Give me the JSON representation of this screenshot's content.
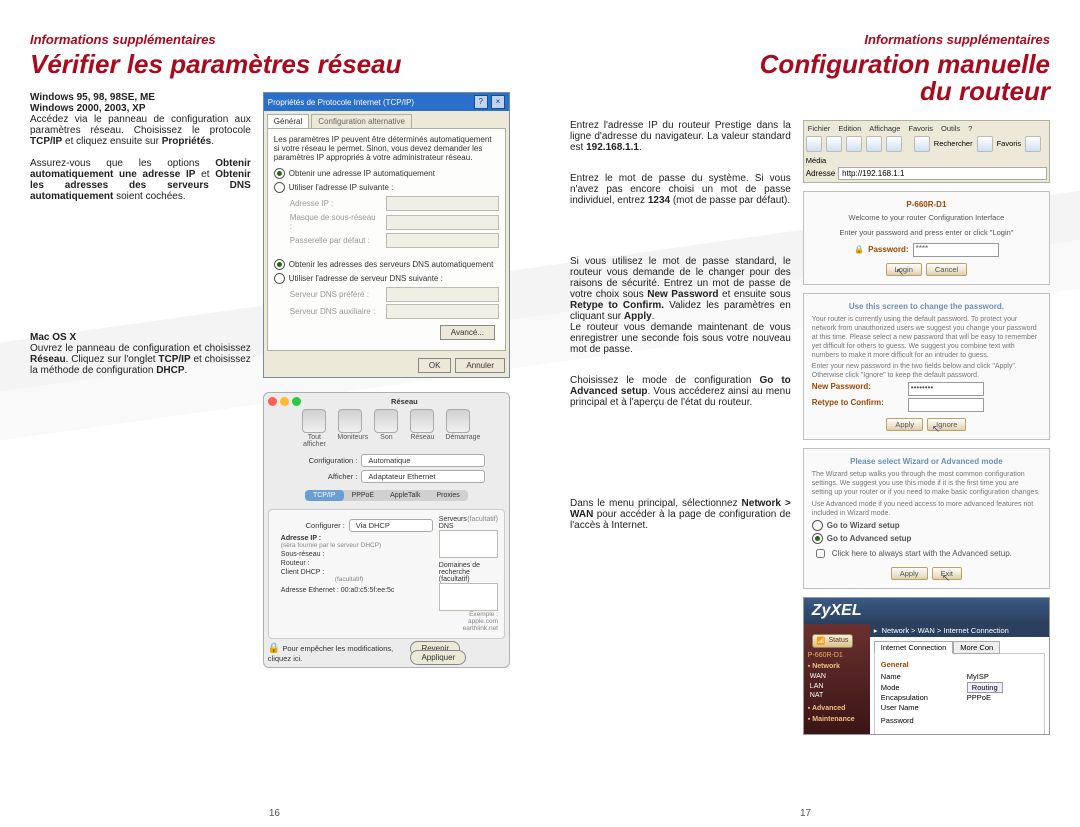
{
  "left": {
    "subheader": "Informations supplémentaires",
    "title": "Vérifier les paramètres réseau",
    "page_num": "16",
    "win_section": {
      "heading1": "Windows 95, 98, 98SE, ME",
      "heading2": "Windows 2000, 2003, XP",
      "p1a": "Accédez via le panneau de configuration aux paramètres réseau. Choisissez le protocole ",
      "p1b": "TCP/IP",
      "p1c": " et cliquez ensuite sur ",
      "p1d": "Propriétés",
      "p1e": ".",
      "p2a": "Assurez-vous que les options ",
      "p2b": "Obtenir automatiquement une adresse IP",
      "p2c": " et ",
      "p2d": "Obtenir les adresses des serveurs DNS automatiquement",
      "p2e": " soient cochées."
    },
    "mac_section": {
      "heading": "Mac OS X",
      "p1a": "Ouvrez le panneau de configuration et choisissez ",
      "p1b": "Réseau",
      "p1c": ". Cliquez sur l'onglet ",
      "p1d": "TCP/IP",
      "p1e": " et choisissez la méthode de configuration ",
      "p1f": "DHCP",
      "p1g": "."
    },
    "tcpip_dialog": {
      "title": "Propriétés de Protocole Internet (TCP/IP)",
      "tab1": "Général",
      "tab2": "Configuration alternative",
      "desc": "Les paramètres IP peuvent être déterminés automatiquement si votre réseau le permet. Sinon, vous devez demander les paramètres IP appropriés à votre administrateur réseau.",
      "r1": "Obtenir une adresse IP automatiquement",
      "r2": "Utiliser l'adresse IP suivante :",
      "f1": "Adresse IP :",
      "f2": "Masque de sous-réseau :",
      "f3": "Passerelle par défaut :",
      "r3": "Obtenir les adresses des serveurs DNS automatiquement",
      "r4": "Utiliser l'adresse de serveur DNS suivante :",
      "f4": "Serveur DNS préféré :",
      "f5": "Serveur DNS auxiliaire :",
      "adv": "Avancé...",
      "ok": "OK",
      "cancel": "Annuler"
    },
    "mac_dialog": {
      "title": "Réseau",
      "tb1": "Tout afficher",
      "tb2": "Moniteurs",
      "tb3": "Son",
      "tb4": "Réseau",
      "tb5": "Démarrage",
      "cfg_lbl": "Configuration :",
      "cfg_val": "Automatique",
      "show_lbl": "Afficher :",
      "show_val": "Adaptateur Ethernet",
      "tab1": "TCP/IP",
      "tab2": "PPPoE",
      "tab3": "AppleTalk",
      "tab4": "Proxies",
      "configurer_lbl": "Configurer :",
      "configurer_val": "Via DHCP",
      "dns_lbl": "Serveurs DNS",
      "dns_opt": "(facultatif)",
      "ip_lbl": "Adresse IP :",
      "ip_note": "(sera fournie par le serveur DHCP)",
      "subnet_lbl": "Sous-réseau :",
      "router_lbl": "Routeur :",
      "search_lbl": "Domaines de recherche (facultatif)",
      "dhcp_lbl": "Client DHCP :",
      "dhcp_opt": "(facultatif)",
      "eth_lbl": "Adresse Ethernet : 00:a0:c5:5f:ee:5c",
      "example": "Exemple : apple.com earthlink.net",
      "lock": "Pour empêcher les modifications, cliquez ici.",
      "revert": "Revenir",
      "apply": "Appliquer"
    }
  },
  "right": {
    "subheader": "Informations supplémentaires",
    "title_l1": "Configuration manuelle",
    "title_l2": "du routeur",
    "page_num": "17",
    "step1a": "Entrez l'adresse IP du routeur Prestige dans la ligne d'adresse du navigateur. La valeur standard est ",
    "step1b": "192.168.1.1",
    "step1c": ".",
    "step2a": "Entrez le mot de passe du système. Si vous n'avez pas encore choisi un mot de passe individuel, entrez ",
    "step2b": "1234",
    "step2c": " (mot de passe par défaut).",
    "step3a": "Si vous utilisez le mot de passe standard, le routeur vous demande de le changer pour des raisons de sécurité. Entrez un mot de passe de votre choix sous ",
    "step3b": "New Password",
    "step3c": " et ensuite sous ",
    "step3d": "Retype to Confirm.",
    "step3e": " Validez les paramètres en cliquant sur ",
    "step3f": "Apply",
    "step3g": ".",
    "step3h": "Le routeur vous demande maintenant de vous enregistrer une seconde fois sous votre nouveau mot de passe.",
    "step4a": "Choisissez le mode de configuration ",
    "step4b": "Go to Advanced setup",
    "step4c": ". Vous accéderez ainsi au menu principal et à l'aperçu de l'état du routeur.",
    "step5a": "Dans le menu principal, sélectionnez ",
    "step5b": "Network > WAN",
    "step5c": " pour accéder à la page de configuration de l'accès à Internet.",
    "browser": {
      "menu": [
        "Fichier",
        "Edition",
        "Affichage",
        "Favoris",
        "Outils",
        "?"
      ],
      "tools": [
        "Rechercher",
        "Favoris",
        "Média"
      ],
      "addr_lbl": "Adresse",
      "addr_val": "http://192.168.1.1"
    },
    "login_pane": {
      "model": "P-660R-D1",
      "welcome": "Welcome to your router Configuration Interface",
      "hint": "Enter your password and press enter or click \"Login\"",
      "pw_lbl": "Password:",
      "pw_val": "****",
      "login": "Login",
      "cancel": "Cancel"
    },
    "change_pw": {
      "title": "Use this screen to change the password.",
      "d1": "Your router is currently using the default password. To protect your network from unauthorized users we suggest you change your password at this time. Please select a new password that will be easy to remember yet difficult for others to guess. We suggest you combine text with numbers to make it more difficult for an intruder to guess.",
      "d2": "Enter your new password in the two fields below and click \"Apply\". Otherwise click \"Ignore\" to keep the default password.",
      "np": "New Password:",
      "rt": "Retype to Confirm:",
      "apply": "Apply",
      "ignore": "Ignore"
    },
    "mode": {
      "title": "Please select Wizard or Advanced mode",
      "d1": "The Wizard setup walks you through the most common configuration settings. We suggest you use this mode if it is the first time you are setting up your router or if you need to make basic configuration changes.",
      "d2": "Use Advanced mode if you need access to more advanced features not included in Wizard mode.",
      "o1": "Go to Wizard setup",
      "o2": "Go to Advanced setup",
      "chk": "Click here to always start with the Advanced setup.",
      "apply": "Apply",
      "exit": "Exit"
    },
    "zyxel": {
      "brand": "ZyXEL",
      "status_btn": "Status",
      "crumb": "Network > WAN > Internet Connection",
      "side_model": "P-660R-D1",
      "side_groups": {
        "network": "Network",
        "items_net": [
          "WAN",
          "LAN",
          "NAT"
        ],
        "advanced": "Advanced",
        "maintenance": "Maintenance"
      },
      "tab1": "Internet Connection",
      "tab2": "More Con",
      "section": "General",
      "rows": {
        "name_l": "Name",
        "name_v": "MyISP",
        "mode_l": "Mode",
        "mode_v": "Routing",
        "enc_l": "Encapsulation",
        "enc_v": "PPPoE",
        "user_l": "User Name",
        "pass_l": "Password"
      }
    }
  }
}
